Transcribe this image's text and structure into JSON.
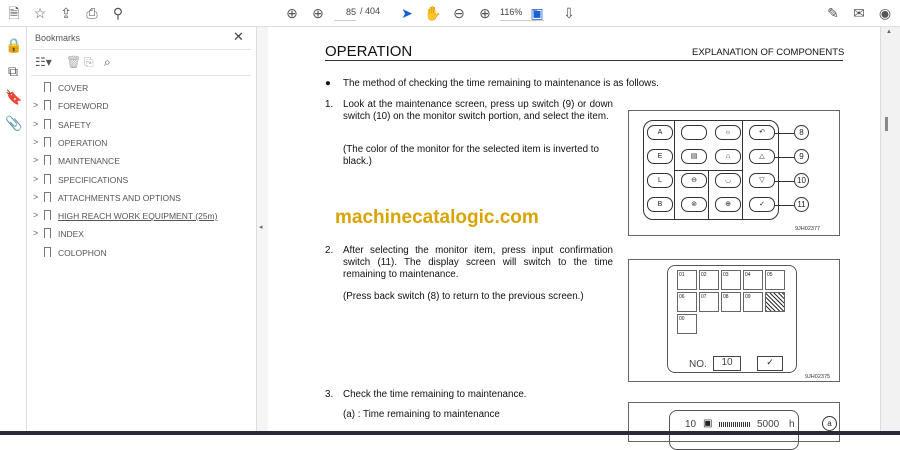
{
  "toolbar": {
    "page_current": "85",
    "page_total": "/ 404",
    "zoom": "116%",
    "icons": [
      "save-icon",
      "star-icon",
      "upload-icon",
      "print-icon",
      "search-icon",
      "page-up-icon",
      "page-down-icon",
      "select-cursor-icon",
      "hand-icon",
      "zoom-out-icon",
      "zoom-in-icon",
      "page-fit-icon",
      "scroll-mode-icon",
      "sign-icon",
      "mail-icon",
      "account-icon"
    ]
  },
  "rail": {
    "icons": [
      "lock-icon",
      "pages-icon",
      "bookmark-icon",
      "attachment-icon"
    ]
  },
  "bookmarks": {
    "title": "Bookmarks",
    "items": [
      {
        "label": "COVER",
        "expandable": false
      },
      {
        "label": "FOREWORD",
        "expandable": true
      },
      {
        "label": "SAFETY",
        "expandable": true
      },
      {
        "label": "OPERATION",
        "expandable": true
      },
      {
        "label": "MAINTENANCE",
        "expandable": true
      },
      {
        "label": "SPECIFICATIONS",
        "expandable": true
      },
      {
        "label": "ATTACHMENTS AND OPTIONS",
        "expandable": true
      },
      {
        "label": "HIGH REACH WORK EQUIPMENT (25m)",
        "expandable": true
      },
      {
        "label": "INDEX",
        "expandable": true
      },
      {
        "label": "COLOPHON",
        "expandable": false
      }
    ]
  },
  "doc": {
    "heading": "OPERATION",
    "section": "EXPLANATION OF COMPONENTS",
    "bullet": "The method of checking the time remaining to maintenance is as follows.",
    "step1_num": "1.",
    "step1": "Look at the maintenance screen, press up switch (9) or down switch (10) on the monitor switch portion, and select the item.",
    "step1_note": "(The color of the monitor for the selected item is inverted to black.)",
    "step2_num": "2.",
    "step2": "After selecting the monitor item, press input confirmation switch (11). The display screen will switch to the time remaining to maintenance.",
    "step2_note": "(Press back switch (8) to return to the previous screen.)",
    "step3_num": "3.",
    "step3": "Check the time remaining to maintenance.",
    "step3_a": "(a) : Time remaining to maintenance",
    "watermark": "machinecatalogic.com",
    "fig1": {
      "code": "9JH02377",
      "keys": [
        "A",
        "E",
        "L",
        "B"
      ],
      "callouts": [
        "8",
        "9",
        "10",
        "11"
      ]
    },
    "fig2": {
      "code": "9JH02375",
      "cells": [
        "01",
        "02",
        "03",
        "04",
        "05",
        "06",
        "07",
        "08",
        "09",
        "",
        "00"
      ],
      "no_label": "NO.",
      "no_value": "10"
    },
    "fig3": {
      "num": "10",
      "value": "5000",
      "unit": "h",
      "callout": "a"
    }
  }
}
